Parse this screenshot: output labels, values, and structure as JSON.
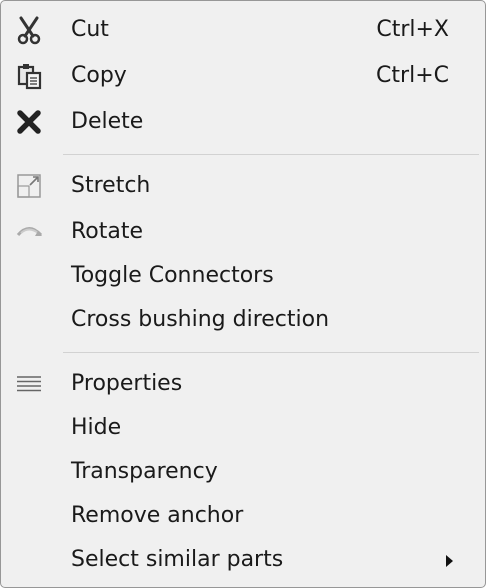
{
  "menu": {
    "items": [
      {
        "label": "Cut",
        "shortcut": "Ctrl+X",
        "icon": "scissors-icon"
      },
      {
        "label": "Copy",
        "shortcut": "Ctrl+C",
        "icon": "copy-icon"
      },
      {
        "label": "Delete",
        "icon": "delete-x-icon"
      },
      {
        "label": "Stretch",
        "icon": "stretch-icon"
      },
      {
        "label": "Rotate",
        "icon": "rotate-icon"
      },
      {
        "label": "Toggle Connectors"
      },
      {
        "label": "Cross bushing direction"
      },
      {
        "label": "Properties",
        "icon": "properties-lines-icon"
      },
      {
        "label": "Hide"
      },
      {
        "label": "Transparency"
      },
      {
        "label": "Remove anchor"
      },
      {
        "label": "Select similar parts",
        "submenu": true
      }
    ]
  },
  "colors": {
    "background": "#f0f0f0",
    "border": "#979797",
    "separator": "#d2d2d2",
    "text": "#1a1a1a"
  }
}
